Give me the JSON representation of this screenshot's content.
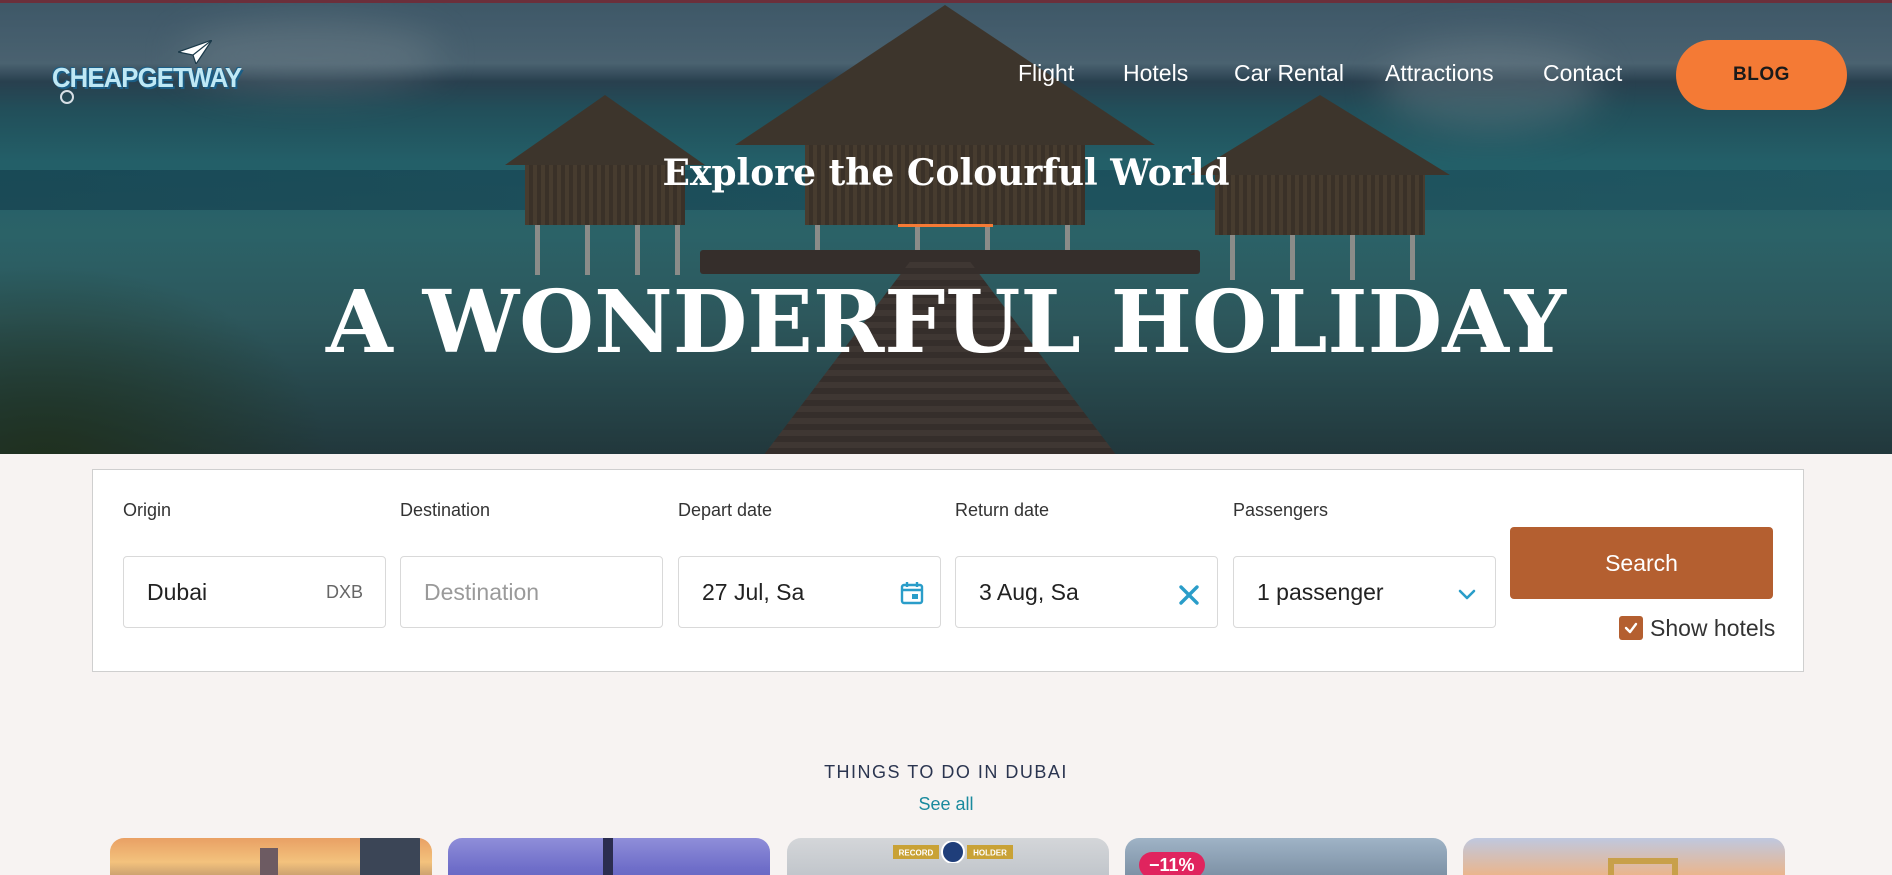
{
  "brand": {
    "logo_text": "CHEAPGETWAY"
  },
  "nav": {
    "items": [
      {
        "label": "Flight"
      },
      {
        "label": "Hotels"
      },
      {
        "label": "Car Rental"
      },
      {
        "label": "Attractions"
      },
      {
        "label": "Contact"
      }
    ],
    "blog_label": "BLOG"
  },
  "hero": {
    "subtitle": "Explore the Colourful World",
    "title": "A WONDERFUL HOLIDAY"
  },
  "search": {
    "origin": {
      "label": "Origin",
      "value": "Dubai",
      "code": "DXB"
    },
    "destination": {
      "label": "Destination",
      "placeholder": "Destination"
    },
    "depart": {
      "label": "Depart date",
      "value": "27 Jul, Sa"
    },
    "return": {
      "label": "Return date",
      "value": "3 Aug, Sa"
    },
    "passengers": {
      "label": "Passengers",
      "value": "1 passenger"
    },
    "search_label": "Search",
    "show_hotels": {
      "label": "Show hotels",
      "checked": true
    }
  },
  "things": {
    "title": "THINGS TO DO IN DUBAI",
    "see_all": "See all",
    "cards": [
      {
        "badge": ""
      },
      {
        "badge": ""
      },
      {
        "badge": "RECORD HOLDER"
      },
      {
        "badge": "−11%"
      },
      {
        "badge": ""
      }
    ]
  },
  "colors": {
    "accent": "#f47a35",
    "search_button": "#b45f30",
    "link": "#1a8a9e",
    "discount_badge": "#e0245e"
  }
}
